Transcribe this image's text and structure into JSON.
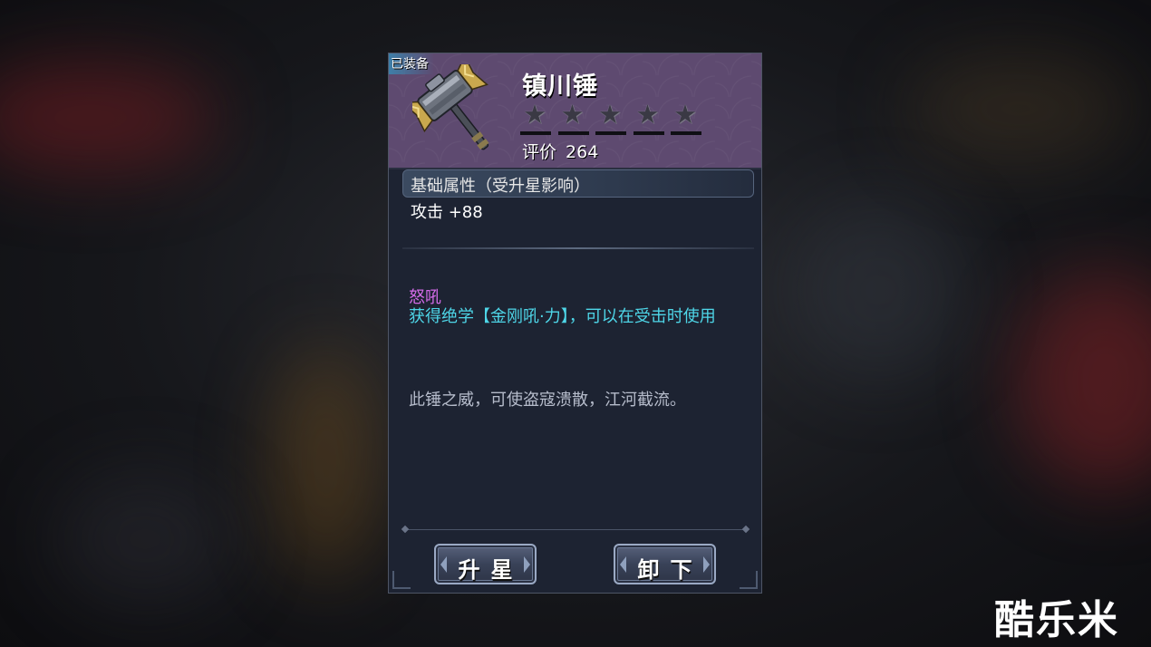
{
  "equipped_badge": "已装备",
  "item": {
    "name": "镇川锤",
    "icon": "war-hammer-icon",
    "stars_filled": 0,
    "stars_total": 5
  },
  "score": {
    "label": "评价",
    "value": "264"
  },
  "base_attributes": {
    "title": "基础属性（受升星影响）",
    "line": "攻击 +88"
  },
  "skill": {
    "name": "怒吼",
    "description": "获得绝学【金刚吼·力】，可以在受击时使用"
  },
  "flavor_text": "此锤之威，可使盗寇溃散，江河截流。",
  "buttons": {
    "upgrade_label": "升星",
    "unequip_label": "卸下"
  },
  "watermark": "酷乐米",
  "colors": {
    "header_bg": "#5e4a70",
    "panel_bg": "#1d2332",
    "skill_name": "#d36be8",
    "skill_desc": "#4ed6e8",
    "flavor": "#b6bccb"
  }
}
